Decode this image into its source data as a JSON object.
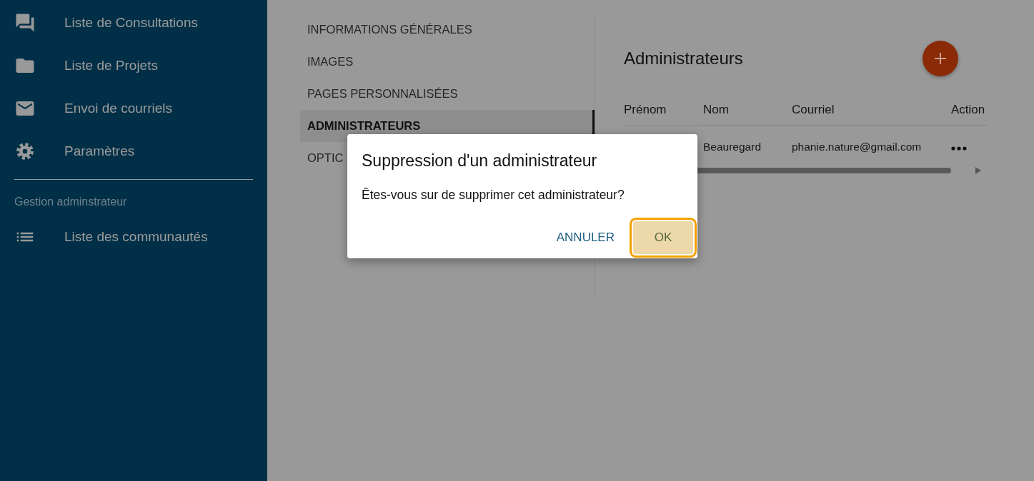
{
  "sidebar": {
    "items": [
      {
        "label": "Liste de Consultations",
        "kind": "chat"
      },
      {
        "label": "Liste de Projets",
        "kind": "folder"
      },
      {
        "label": "Envoi de courriels",
        "kind": "mail"
      },
      {
        "label": "Paramètres",
        "kind": "gear"
      }
    ],
    "section_label": "Gestion adminstrateur",
    "section_items": [
      {
        "label": "Liste des communautés",
        "kind": "list"
      }
    ]
  },
  "tabs": [
    {
      "label": "INFORMATIONS GÉNÉRALES",
      "selected": false
    },
    {
      "label": "IMAGES",
      "selected": false
    },
    {
      "label": "PAGES PERSONNALISÉES",
      "selected": false
    },
    {
      "label": "ADMINISTRATEURS",
      "selected": true
    },
    {
      "label": "OPTIC",
      "selected": false
    }
  ],
  "panel": {
    "title": "Administrateurs",
    "table": {
      "columns": [
        "Prénom",
        "Nom",
        "Courriel",
        "Action"
      ],
      "rows": [
        {
          "nom": "Beauregard",
          "courriel": "phanie.nature@gmail.com"
        }
      ]
    }
  },
  "dialog": {
    "title": "Suppression d'un administrateur",
    "message": "Êtes-vous sur de supprimer cet administrateur?",
    "buttons": [
      {
        "label": "ANNULER",
        "kind": "text",
        "focused": false
      },
      {
        "label": "OK",
        "kind": "filled",
        "focused": true
      }
    ]
  }
}
